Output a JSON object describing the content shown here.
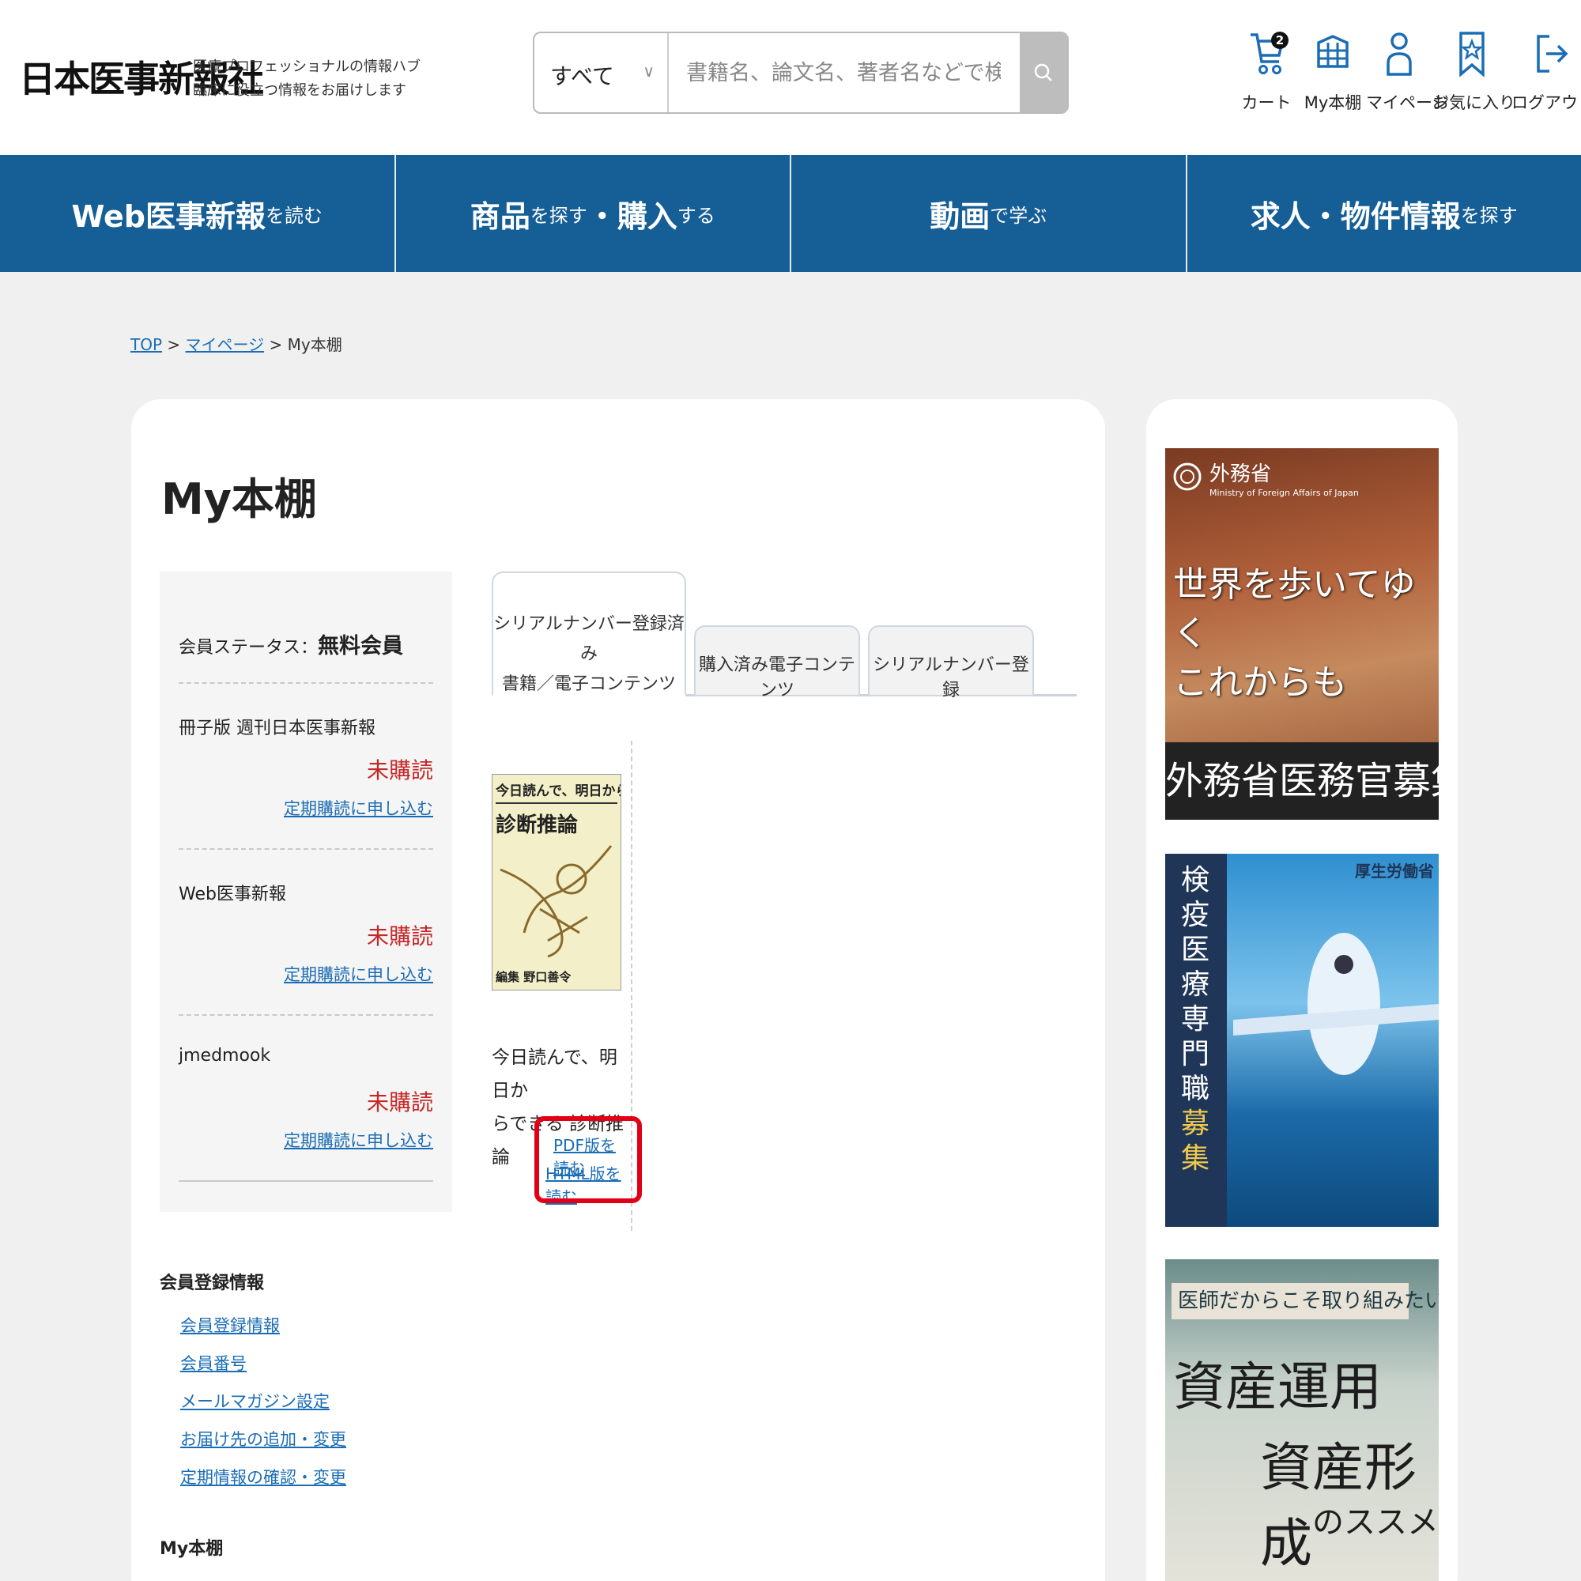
{
  "header": {
    "logo": "日本医事新報社",
    "tagline_1": "医療プロフェッショナルの情報ハブ",
    "tagline_2": "臨床に役立つ情報をお届けします",
    "search_scope": "すべて",
    "search_placeholder": "書籍名、論文名、著者名などで検索",
    "cart_count": "2",
    "icons": [
      {
        "label": "カート",
        "icon": "cart-icon"
      },
      {
        "label": "My本棚",
        "icon": "bookshelf-icon"
      },
      {
        "label": "マイページ",
        "icon": "user-icon"
      },
      {
        "label": "お気に入り",
        "icon": "bookmark-star-icon"
      },
      {
        "label": "ログアウト",
        "icon": "logout-icon"
      }
    ]
  },
  "nav": [
    {
      "big": "Web医事新報",
      "small": "を読む"
    },
    {
      "big": "商品",
      "small": "を探す",
      "big2": "・購入",
      "small2": "する"
    },
    {
      "big": "動画",
      "small": "で学ぶ"
    },
    {
      "big": "求人・物件情報",
      "small": "を探す"
    }
  ],
  "breadcrumb": {
    "top": "TOP",
    "sep": ">",
    "mypage": "マイページ",
    "current": "My本棚"
  },
  "page_title": "My本棚",
  "status": {
    "label": "会員ステータス：",
    "value": "無料会員",
    "subscriptions": [
      {
        "name": "冊子版 週刊日本医事新報",
        "state": "未購読",
        "link": "定期購読に申し込む"
      },
      {
        "name": "Web医事新報",
        "state": "未購読",
        "link": "定期購読に申し込む"
      },
      {
        "name": "jmedmook",
        "state": "未購読",
        "link": "定期購読に申し込む"
      }
    ]
  },
  "tabs": [
    {
      "line1": "シリアルナンバー登録済み",
      "line2": "書籍／電子コンテンツ"
    },
    {
      "line1": "購入済み電子コンテンツ"
    },
    {
      "line1": "シリアルナンバー登録"
    }
  ],
  "book": {
    "cover_top": "今日読んで、明日からできる",
    "cover_title": "診断推論",
    "cover_author": "編集 野口善令",
    "title_line1": "今日読んで、明日か",
    "title_line2": "らできる 診断推論",
    "pdf_link": "PDF版を読む",
    "html_link": "HTML版を読む"
  },
  "member_section": {
    "title": "会員登録情報",
    "links": [
      "会員登録情報",
      "会員番号",
      "メールマガジン設定",
      "お届け先の追加・変更",
      "定期情報の確認・変更"
    ]
  },
  "shelf_section_title": "My本棚",
  "banners": {
    "mofa_org": "外務省",
    "mofa_org_en": "Ministry of Foreign Affairs of Japan",
    "mofa_line1": "世界を歩いてゆく",
    "mofa_line2": "これからも",
    "mofa_bottom": "外務省医務官募集",
    "mhlw_org": "厚生労働省",
    "mhlw_text": "検疫医療専門職",
    "mhlw_text2": "募集",
    "asset_tag": "医師だからこそ取り組みたい",
    "asset_line1": "資産運用",
    "asset_line2": "資産形成",
    "asset_line3": "のススメ"
  },
  "colors": {
    "nav": "#155e96",
    "link": "#1a6db5",
    "unsubscribed": "#c62828",
    "highlight": "#e10016"
  }
}
